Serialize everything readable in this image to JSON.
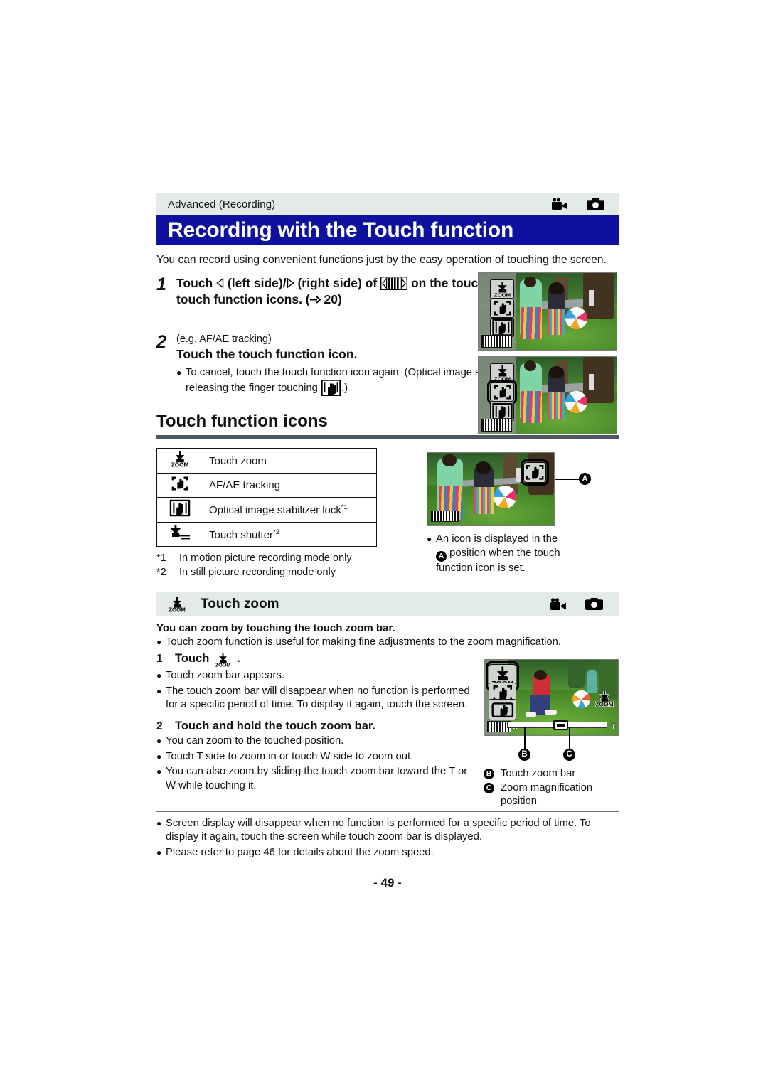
{
  "header": {
    "breadcrumb": "Advanced (Recording)",
    "title": "Recording with the Touch function",
    "mode_icons": [
      "video-camera-icon",
      "still-camera-icon"
    ],
    "title_bg": "#0d119e",
    "band_bg": "#e3ebe9"
  },
  "intro": "You can record using convenient functions just by the easy operation of touching the screen.",
  "steps": [
    {
      "num": "1",
      "title_part1": "Touch ",
      "title_part2": " (left side)/",
      "title_part3": " (right side) of ",
      "title_part4": " on the touch menu to display touch function icons. (",
      "title_ref": "20",
      "title_part5": ")"
    },
    {
      "num": "2",
      "sub": "(e.g. AF/AE tracking)",
      "title": "Touch the touch function icon.",
      "bullet": "To cancel, touch the touch function icon again. (Optical image stabilizer lock is cancelled by releasing the finger touching",
      "bullet_tail": ".)"
    }
  ],
  "section": {
    "heading": "Touch function icons",
    "table": {
      "rows": [
        {
          "icon": "touch-zoom-icon",
          "label": "Touch zoom",
          "footnote": ""
        },
        {
          "icon": "af-ae-tracking-icon",
          "label": "AF/AE tracking",
          "footnote": ""
        },
        {
          "icon": "optical-image-stabilizer-lock-icon",
          "label": "Optical image stabilizer lock",
          "footnote": "*1"
        },
        {
          "icon": "touch-shutter-icon",
          "label": "Touch shutter",
          "footnote": "*2"
        }
      ]
    },
    "footnotes": [
      {
        "mark": "*1",
        "text": "In motion picture recording mode only"
      },
      {
        "mark": "*2",
        "text": "In still picture recording mode only"
      }
    ],
    "figure_note": {
      "line1": "An icon is displayed in the",
      "cap": "A",
      "line2": "position when the touch",
      "line3": "function icon is set."
    }
  },
  "touch_zoom": {
    "band_title": "Touch zoom",
    "band_icon": "touch-zoom-icon",
    "mode_icons": [
      "video-camera-icon",
      "still-camera-icon"
    ],
    "lead": "You can zoom by touching the touch zoom bar.",
    "bullet_top": "Touch zoom function is useful for making fine adjustments to the zoom magnification.",
    "step1": {
      "num": "1",
      "label": "Touch",
      "icon": "touch-zoom-icon",
      "period": ".",
      "bullets": [
        "Touch zoom bar appears.",
        "The touch zoom bar will disappear when no function is performed for a specific period of time. To display it again, touch the screen."
      ]
    },
    "step2": {
      "num": "2",
      "title": "Touch and hold the touch zoom bar.",
      "bullets": [
        "You can zoom to the touched position.",
        "Touch T side to zoom in or touch W side to zoom out.",
        "You can also zoom by sliding the touch zoom bar toward the T or W while touching it."
      ]
    },
    "callouts": [
      {
        "cap": "B",
        "text": "Touch zoom bar"
      },
      {
        "cap": "C",
        "text": "Zoom magnification position"
      }
    ],
    "zoom_bar": {
      "w_label": "W",
      "t_label": "T"
    }
  },
  "footer_notes": [
    "Screen display will disappear when no function is performed for a specific period of time. To display it again, touch the screen while touch zoom bar is displayed.",
    "Please refer to page 46 for details about the zoom speed."
  ],
  "page_number": "- 49 -"
}
